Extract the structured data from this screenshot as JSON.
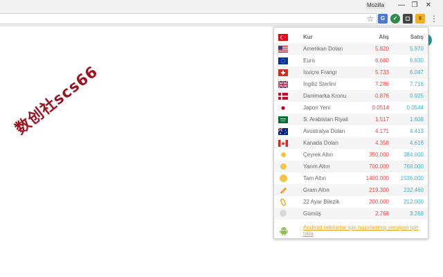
{
  "browser": {
    "profile_name": "Mozilla",
    "minimize_glyph": "—",
    "maximize_glyph": "❐",
    "close_glyph": "✕",
    "star_glyph": "☆",
    "menu_glyph": "⋮"
  },
  "watermark": "数创社scs66",
  "popup": {
    "header": {
      "name": "Kur",
      "buy": "Alış",
      "sell": "Satış",
      "icon": "flag-tr"
    },
    "rows": [
      {
        "name": "Amerikan Doları",
        "buy": "5.820",
        "sell": "5.970",
        "icon": "flag-us"
      },
      {
        "name": "Euro",
        "buy": "6.660",
        "sell": "6.830",
        "icon": "flag-eu"
      },
      {
        "name": "İsviçre Frangı",
        "buy": "5.733",
        "sell": "6.047",
        "icon": "flag-ch"
      },
      {
        "name": "İngiliz Sterlini",
        "buy": "7.286",
        "sell": "7.716",
        "icon": "flag-gb"
      },
      {
        "name": "Danimarka Kronu",
        "buy": "0.876",
        "sell": "0.925",
        "icon": "flag-dk"
      },
      {
        "name": "Japon Yeni",
        "buy": "0.0514",
        "sell": "0.0544",
        "icon": "flag-jp"
      },
      {
        "name": "S. Arabistan Riyali",
        "buy": "1.517",
        "sell": "1.608",
        "icon": "flag-sa"
      },
      {
        "name": "Avustralya Doları",
        "buy": "4.171",
        "sell": "4.413",
        "icon": "flag-au"
      },
      {
        "name": "Kanada Doları",
        "buy": "4.358",
        "sell": "4.616",
        "icon": "flag-ca"
      },
      {
        "name": "Çeyrek Altın",
        "buy": "350.000",
        "sell": "384.000",
        "icon": "gold-coin-small-icon"
      },
      {
        "name": "Yarım Altın",
        "buy": "700.000",
        "sell": "768.000",
        "icon": "gold-coin-icon"
      },
      {
        "name": "Tam Altın",
        "buy": "1400.000",
        "sell": "1536.000",
        "icon": "gold-coin-large-icon"
      },
      {
        "name": "Gram Altın",
        "buy": "219.300",
        "sell": "232.460",
        "icon": "gold-bar-icon"
      },
      {
        "name": "22 Ayar Bilezik",
        "buy": "200.000",
        "sell": "212.000",
        "icon": "bracelet-icon"
      },
      {
        "name": "Gümüş",
        "buy": "2.768",
        "sell": "3.268",
        "icon": "silver-coin-icon"
      }
    ],
    "footer_link": "Android telefonlar için hazırlanmış versiyon için tıkla",
    "colors": {
      "buy": "#ee4444",
      "sell": "#3cb0c2",
      "link": "#e8a317"
    }
  }
}
